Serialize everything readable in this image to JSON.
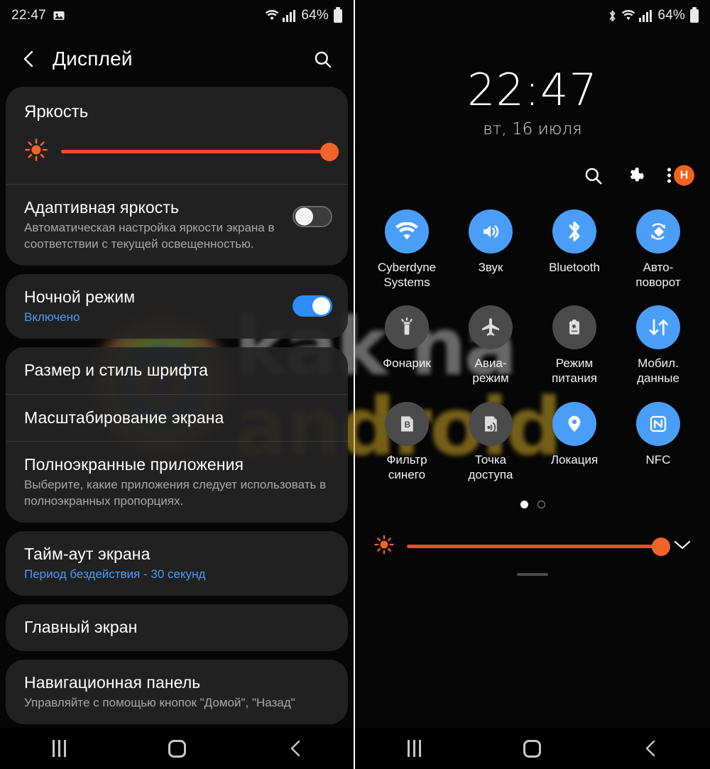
{
  "left": {
    "statusbar": {
      "time": "22:47",
      "battery_percent": "64%",
      "icons": [
        "image-icon",
        "wifi-icon",
        "signal-icon",
        "battery-icon"
      ]
    },
    "header": {
      "title": "Дисплей",
      "back_icon": "back-chevron-icon",
      "search_icon": "search-icon"
    },
    "brightness": {
      "title": "Яркость",
      "icon": "brightness-sun-icon",
      "value": 100,
      "accent": "#f2632c",
      "track": "#ef4b31"
    },
    "adaptive": {
      "title": "Адаптивная яркость",
      "subtitle": "Автоматическая настройка яркости экрана в соответствии с текущей освещенностью.",
      "toggle_state": "off"
    },
    "night_mode": {
      "title": "Ночной режим",
      "subtitle": "Включено",
      "toggle_state": "on",
      "accent": "#2d8cf5"
    },
    "font_size": {
      "title": "Размер и стиль шрифта"
    },
    "screen_zoom": {
      "title": "Масштабирование экрана"
    },
    "fullscreen_apps": {
      "title": "Полноэкранные приложения",
      "subtitle": "Выберите, какие приложения следует использовать в полноэкранных пропорциях."
    },
    "screen_timeout": {
      "title": "Тайм-аут экрана",
      "subtitle": "Период бездействия - 30 секунд"
    },
    "home_screen": {
      "title": "Главный экран"
    },
    "nav_bar": {
      "title": "Навигационная панель",
      "subtitle": "Управляйте с помощью кнопок \"Домой\", \"Назад\""
    }
  },
  "right": {
    "statusbar": {
      "battery_percent": "64%",
      "icons": [
        "bluetooth-icon",
        "wifi-icon",
        "signal-icon",
        "battery-icon"
      ]
    },
    "clock": {
      "time": "22:47",
      "date": "вт, 16 июля"
    },
    "actions": {
      "search_icon": "search-icon",
      "settings_icon": "gear-icon",
      "menu_icon": "overflow-menu-icon",
      "avatar_letter": "H",
      "avatar_color": "#f4621f"
    },
    "tiles": [
      {
        "label": "Cyberdyne\nSystems",
        "icon": "wifi-icon",
        "state": "on"
      },
      {
        "label": "Звук",
        "icon": "volume-icon",
        "state": "on"
      },
      {
        "label": "Bluetooth",
        "icon": "bluetooth-icon",
        "state": "on"
      },
      {
        "label": "Авто-\nповорот",
        "icon": "auto-rotate-icon",
        "state": "on"
      },
      {
        "label": "Фонарик",
        "icon": "flashlight-icon",
        "state": "off"
      },
      {
        "label": "Авиа-\nрежим",
        "icon": "airplane-icon",
        "state": "off"
      },
      {
        "label": "Режим\nпитания",
        "icon": "power-mode-icon",
        "state": "off"
      },
      {
        "label": "Мобил.\nданные",
        "icon": "mobile-data-icon",
        "state": "on"
      },
      {
        "label": "Фильтр\nсинего",
        "icon": "blue-light-filter-icon",
        "state": "off"
      },
      {
        "label": "Точка\nдоступа",
        "icon": "hotspot-icon",
        "state": "off"
      },
      {
        "label": "Локация",
        "icon": "location-pin-icon",
        "state": "on"
      },
      {
        "label": "NFC",
        "icon": "nfc-icon",
        "state": "on"
      }
    ],
    "pager": {
      "pages": 2,
      "active": 1
    },
    "brightness": {
      "icon": "brightness-sun-icon",
      "value": 100,
      "expand_icon": "chevron-down-icon"
    }
  },
  "navbar": {
    "recents_icon": "recents-icon",
    "home_icon": "home-icon",
    "back_icon": "back-icon"
  },
  "watermark": {
    "line1": "kak na",
    "line2": "android"
  }
}
